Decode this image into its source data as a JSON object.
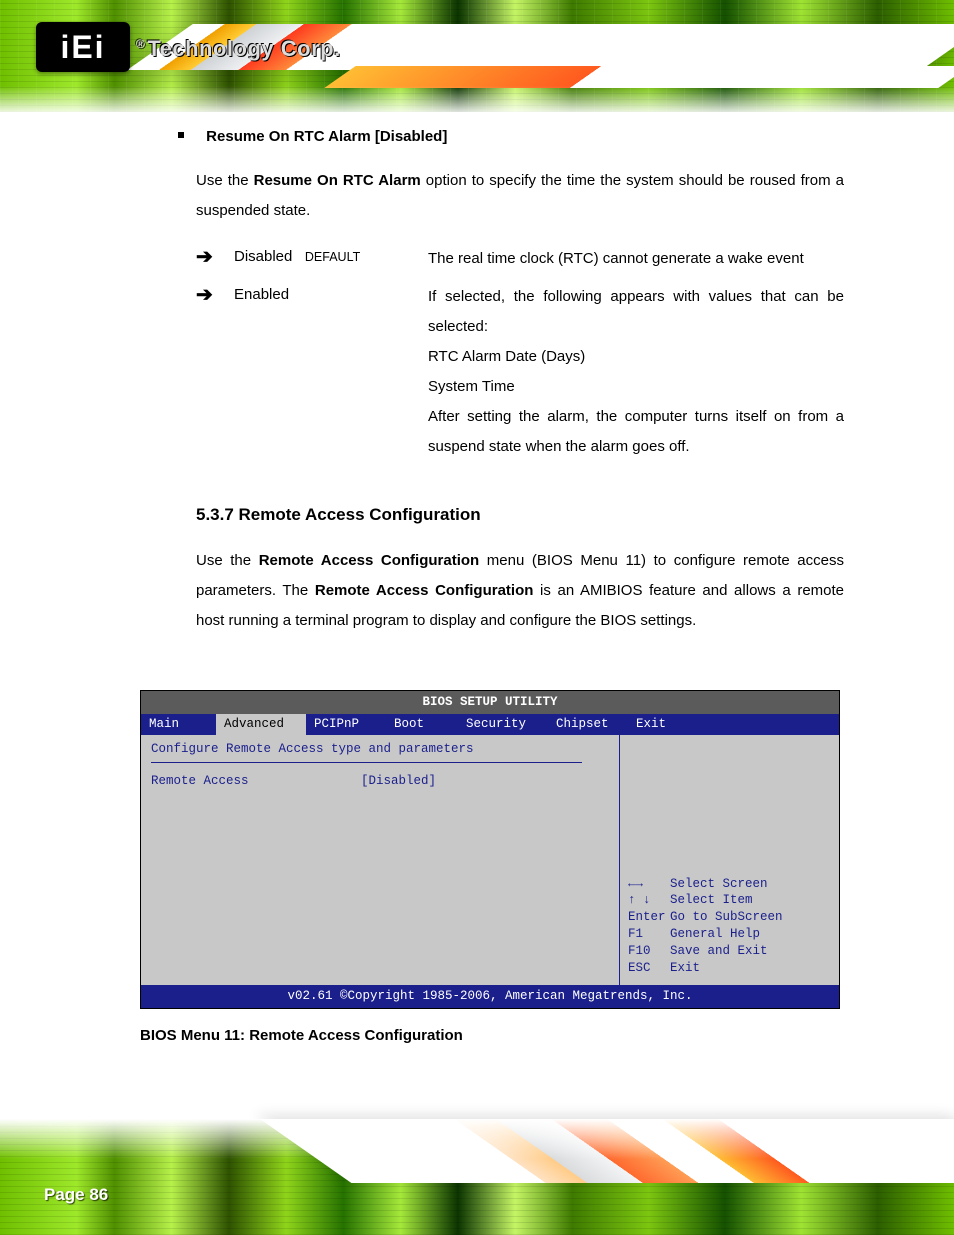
{
  "banner": {
    "logo_text": "iEi",
    "tagline_prefix": "®",
    "tagline": "Technology Corp."
  },
  "section1": {
    "bullet_label": "Resume On RTC Alarm [Disabled]",
    "intro_pre": "Use the ",
    "intro_bold": "Resume On RTC Alarm",
    "intro_post": " option to specify the time the system should be roused from a suspended state.",
    "opts": [
      {
        "label": "Disabled",
        "default": "DEFAULT",
        "desc": "The real time clock (RTC) cannot generate a wake event"
      },
      {
        "label": "Enabled",
        "default": "",
        "desc": "If selected, the following appears with values that can be selected:",
        "lines": [
          "RTC Alarm Date (Days)",
          "System Time",
          "After setting the alarm, the computer turns itself on from a suspend state when the alarm goes off."
        ]
      }
    ]
  },
  "section2": {
    "heading": "5.3.7 Remote Access Configuration",
    "para_1": "Use the ",
    "para_bold1": "Remote Access Configuration",
    "para_2": " menu (",
    "para_ref": "BIOS Menu 11",
    "para_3": ") to configure remote access parameters. The ",
    "para_bold2": "Remote Access Configuration",
    "para_4": " is an AMIBIOS feature and allows a remote host running a terminal program to display and configure the BIOS settings."
  },
  "bios": {
    "title": "BIOS SETUP UTILITY",
    "tabs": [
      "Main",
      "Advanced",
      "PCIPnP",
      "Boot",
      "Security",
      "Chipset",
      "Exit"
    ],
    "left_heading": "Configure Remote Access type and parameters",
    "setting_key": "Remote Access",
    "setting_val": "[Disabled]",
    "right_top": "",
    "help": [
      {
        "k": "←→",
        "d": "Select Screen"
      },
      {
        "k": "↑ ↓",
        "d": "Select Item"
      },
      {
        "k": "Enter",
        "d": "Go to SubScreen"
      },
      {
        "k": "F1",
        "d": "General Help"
      },
      {
        "k": "F10",
        "d": "Save and Exit"
      },
      {
        "k": "ESC",
        "d": "Exit"
      }
    ],
    "footer": "v02.61 ©Copyright 1985-2006, American Megatrends, Inc.",
    "caption": "BIOS Menu 11: Remote Access Configuration"
  },
  "page": {
    "number": "Page 86"
  }
}
